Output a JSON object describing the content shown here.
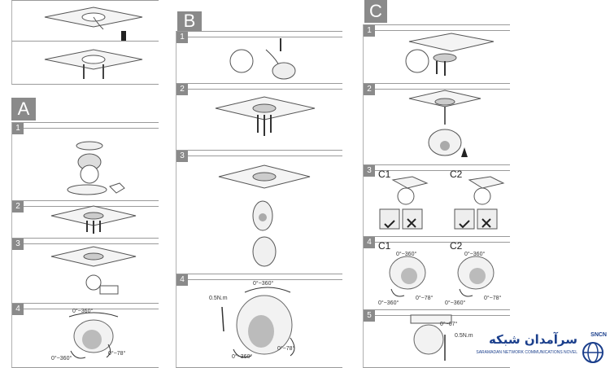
{
  "section_a": {
    "letter": "A",
    "steps": [
      {
        "num": "1"
      },
      {
        "num": "2"
      },
      {
        "num": "3"
      },
      {
        "num": "4"
      }
    ],
    "step4_notes": {
      "pan": "0°~360°",
      "rotate": "0°~360°",
      "tilt": "0°~78°"
    }
  },
  "section_b": {
    "letter": "B",
    "steps": [
      {
        "num": "1"
      },
      {
        "num": "2"
      },
      {
        "num": "3"
      },
      {
        "num": "4"
      }
    ],
    "step4_notes": {
      "torque": "0.5N.m",
      "pan": "0°~360°",
      "rotate": "0°~360°",
      "tilt": "0°~78°"
    }
  },
  "section_c": {
    "letter": "C",
    "steps": [
      {
        "num": "1"
      },
      {
        "num": "2"
      },
      {
        "num": "3"
      },
      {
        "num": "4"
      },
      {
        "num": "5"
      }
    ],
    "step3_options": {
      "c1": "C1",
      "c2": "C2"
    },
    "step4_options": {
      "c1": "C1",
      "c2": "C2"
    },
    "step4_notes": {
      "c1_pan": "0°~360°",
      "c1_rotate": "0°~360°",
      "c1_tilt": "0°~78°",
      "c2_pan": "0°~360°",
      "c2_rotate": "0°~360°",
      "c2_tilt": "0°~78°"
    },
    "step5_notes": {
      "torque": "0.5N.m",
      "angle": "0°~67°"
    }
  },
  "watermark": {
    "persian": "سرآمدان شبکه",
    "english": "SARAMADAN NETWORK COMMUNICATIONS NOVEL",
    "acronym": "SNCN"
  },
  "colors": {
    "panel_border": "#9a9a9a",
    "step_bg": "#8a8a8a",
    "letter_bg": "#8a8a8a",
    "logo_blue": "#1b3f8c"
  }
}
